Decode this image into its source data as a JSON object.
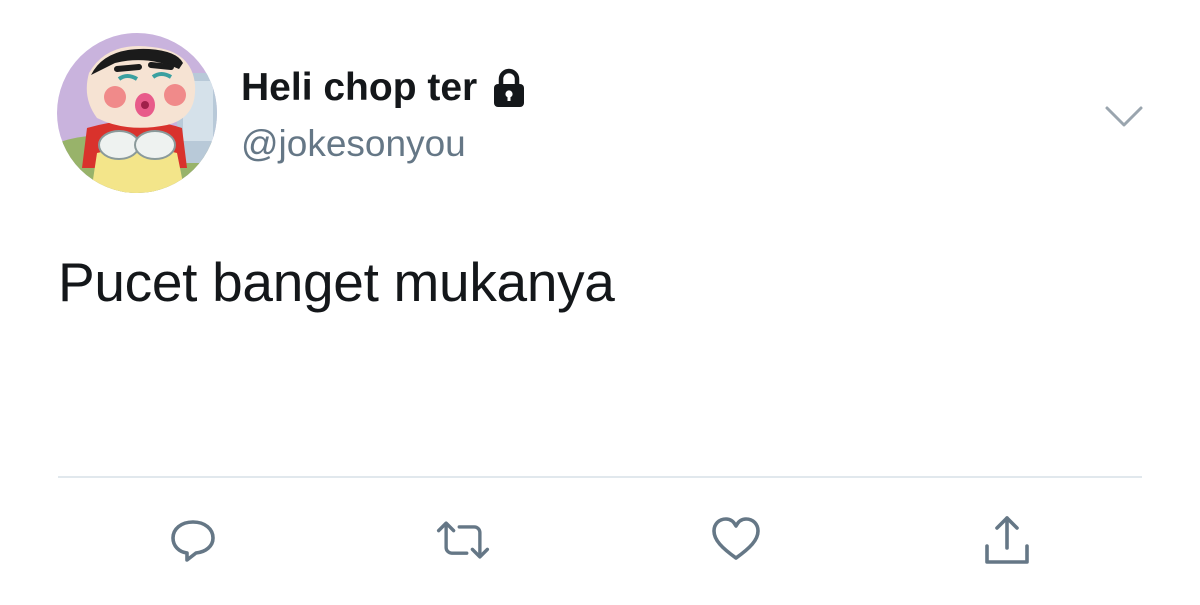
{
  "tweet": {
    "display_name": "Heli chop ter",
    "handle": "@jokesonyou",
    "text": "Pucet banget mukanya",
    "protected": true
  },
  "icons": {
    "lock": "lock-icon",
    "menu": "chevron-down-icon",
    "reply": "reply-icon",
    "retweet": "retweet-icon",
    "like": "heart-icon",
    "share": "share-icon"
  },
  "colors": {
    "text_primary": "#14171a",
    "text_secondary": "#657786",
    "icon": "#657786",
    "divider": "#e1e8ed"
  }
}
